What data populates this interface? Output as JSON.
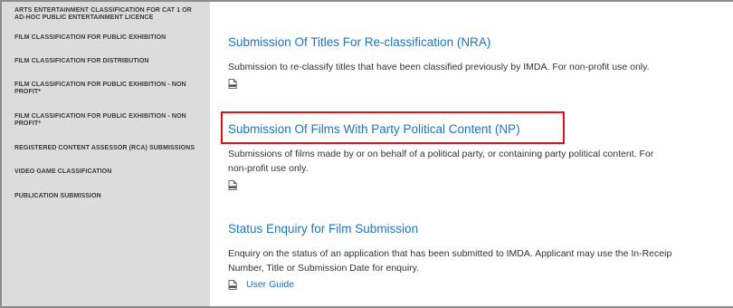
{
  "sidebar": {
    "items": [
      {
        "label": "ARTS ENTERTAINMENT CLASSIFICATION FOR CAT 1 OR AD-HOC PUBLIC ENTERTAINMENT LICENCE"
      },
      {
        "label": "FILM CLASSIFICATION FOR PUBLIC EXHIBITION"
      },
      {
        "label": "FILM CLASSIFICATION FOR DISTRIBUTION"
      },
      {
        "label": "FILM CLASSIFICATION FOR PUBLIC EXHIBITION - NON PROFIT*"
      },
      {
        "label": "FILM CLASSIFICATION FOR PUBLIC EXHIBITION - NON PROFIT*"
      },
      {
        "label": "REGISTERED CONTENT ASSESSOR (RCA) SUBMISSIONS"
      },
      {
        "label": "VIDEO GAME CLASSIFICATION"
      },
      {
        "label": "PUBLICATION SUBMISSION"
      }
    ]
  },
  "main": {
    "sections": [
      {
        "title": "Submission Of Titles For Re-classification (NRA)",
        "description_lines": [
          "Submission to re-classify titles that have been classified previously by IMDA. For non-profit use only."
        ],
        "icon": "document-icon"
      },
      {
        "title": "Submission Of Films With Party Political Content (NP)",
        "description_lines": [
          "Submissions of films made by or on behalf of a political party, or containing party political content. For",
          "non-profit use only."
        ],
        "icon": "document-icon",
        "highlighted": true,
        "highlight_color": "#e4111a"
      },
      {
        "title": "Status Enquiry for Film Submission",
        "description_lines": [
          "Enquiry on the status of an application that has been submitted to IMDA. Applicant may use the In-Receip",
          "Number, Title or Submission Date for enquiry."
        ],
        "icon": "document-icon",
        "link_label": "User Guide"
      }
    ]
  },
  "colors": {
    "link": "#1e73be",
    "sidebar_bg": "#dcdcdc",
    "highlight": "#e4111a",
    "text": "#333333"
  }
}
